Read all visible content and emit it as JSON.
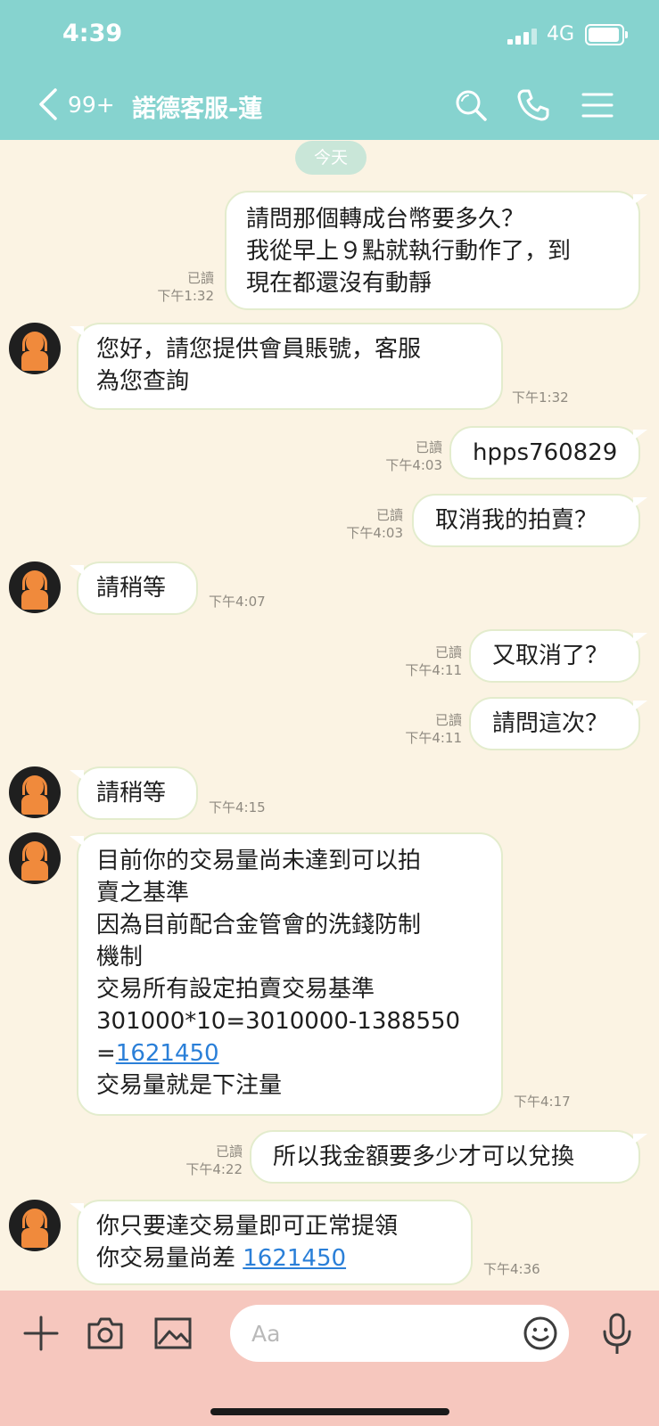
{
  "status": {
    "time": "4:39",
    "network": "4G"
  },
  "header": {
    "back_count": "99+",
    "title": "諾德客服-蓮"
  },
  "chat": {
    "date_divider": "今天",
    "messages": [
      {
        "dir": "out",
        "text": "請問那個轉成台幣要多久？\n我從早上９點就執行動作了，到\n現在都還沒有動靜",
        "read": "已讀",
        "time": "下午1:32"
      },
      {
        "dir": "in",
        "text": "您好，請您提供會員賬號，客服\n為您查詢",
        "time": "下午1:32"
      },
      {
        "dir": "out",
        "text": "hpps760829",
        "read": "已讀",
        "time": "下午4:03"
      },
      {
        "dir": "out",
        "text": "取消我的拍賣？",
        "read": "已讀",
        "time": "下午4:03"
      },
      {
        "dir": "in",
        "text": "請稍等",
        "time": "下午4:07"
      },
      {
        "dir": "out",
        "text": "又取消了？",
        "read": "已讀",
        "time": "下午4:11"
      },
      {
        "dir": "out",
        "text": "請問這次？",
        "read": "已讀",
        "time": "下午4:11"
      },
      {
        "dir": "in",
        "text": "請稍等",
        "time": "下午4:15"
      },
      {
        "dir": "in",
        "text_before": "目前你的交易量尚未達到可以拍\n賣之基準\n因為目前配合金管會的洗錢防制\n機制\n交易所有設定拍賣交易基準\n301000*10=3010000-1388550\n=",
        "link": "1621450",
        "text_after": "\n交易量就是下注量",
        "time": "下午4:17"
      },
      {
        "dir": "out",
        "text": "所以我金額要多少才可以兌換",
        "read": "已讀",
        "time": "下午4:22"
      },
      {
        "dir": "in",
        "text_before": "你只要達交易量即可正常提領\n你交易量尚差 ",
        "link": "1621450",
        "text_after": "",
        "time": "下午4:36"
      }
    ]
  },
  "composer": {
    "placeholder": "Aa"
  },
  "icons": [
    "chevron-left-icon",
    "search-icon",
    "phone-icon",
    "menu-icon",
    "plus-icon",
    "camera-icon",
    "image-icon",
    "emoji-icon",
    "microphone-icon"
  ],
  "colors": {
    "header": "#86d3cf",
    "background": "#fbf3e3",
    "bottom_bar": "#f6c7be",
    "link": "#2a7fd8"
  }
}
